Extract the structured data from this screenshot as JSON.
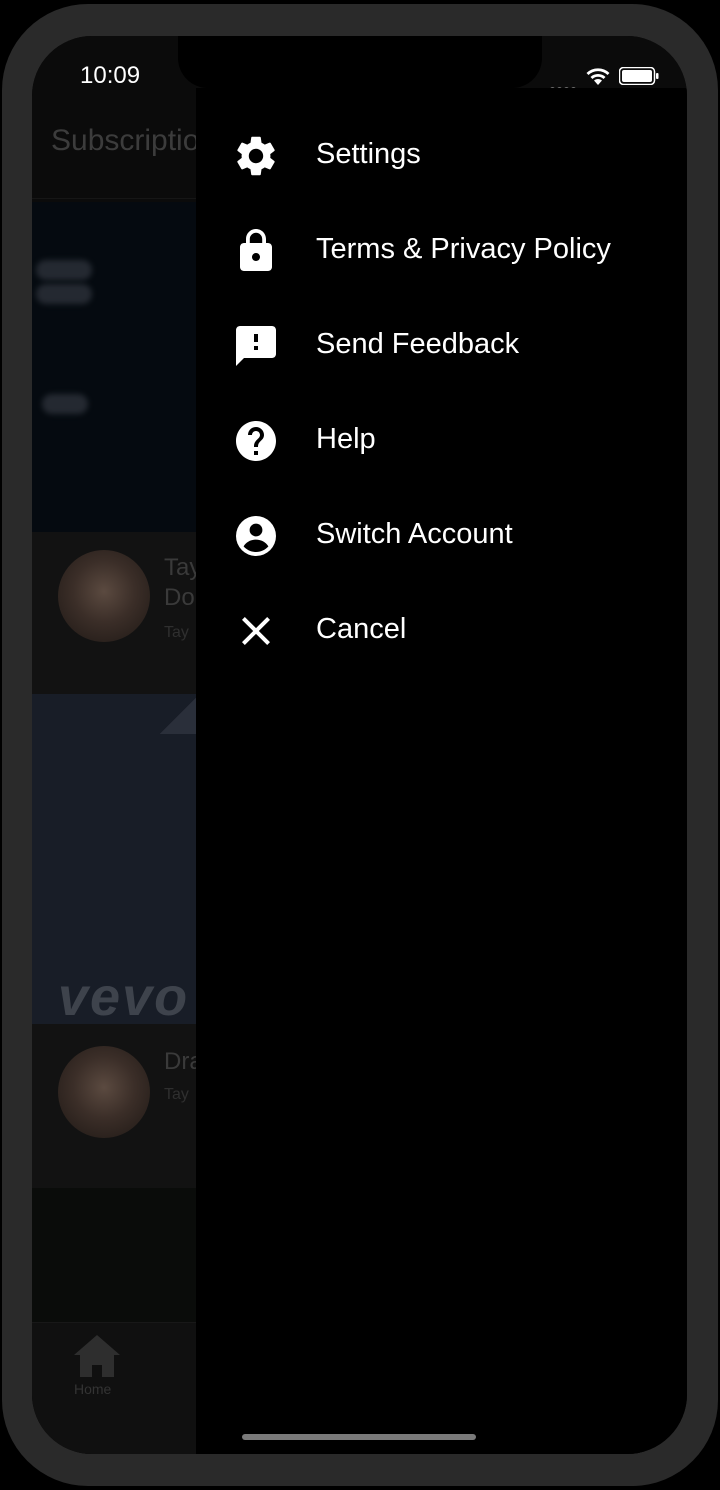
{
  "status_bar": {
    "time": "10:09"
  },
  "background_app": {
    "title": "Subscriptio",
    "videos": [
      {
        "title_line1": "Tay",
        "title_line2": "Do",
        "channel": "Tay"
      },
      {
        "title_line1": "Dra",
        "title_line2": "",
        "channel": "Tay"
      }
    ],
    "brand_watermark": "vevo",
    "tabbar": {
      "home_label": "Home"
    }
  },
  "drawer": {
    "items": [
      {
        "label": "Settings",
        "icon": "gear-icon"
      },
      {
        "label": "Terms & Privacy Policy",
        "icon": "lock-icon"
      },
      {
        "label": "Send Feedback",
        "icon": "feedback-icon"
      },
      {
        "label": "Help",
        "icon": "help-icon"
      },
      {
        "label": "Switch Account",
        "icon": "account-icon"
      },
      {
        "label": "Cancel",
        "icon": "close-icon"
      }
    ]
  }
}
